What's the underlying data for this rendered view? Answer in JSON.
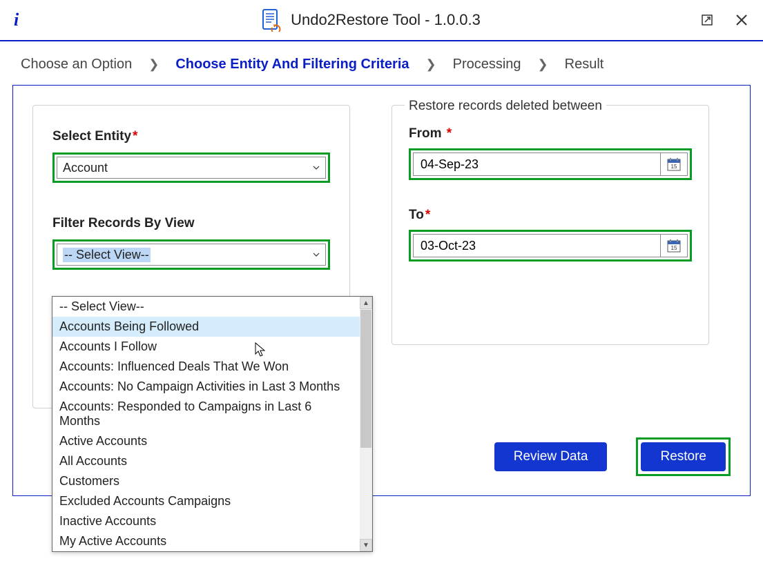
{
  "titlebar": {
    "app_title": "Undo2Restore Tool - 1.0.0.3"
  },
  "breadcrumb": {
    "step1": "Choose an Option",
    "step2": "Choose Entity And Filtering Criteria",
    "step3": "Processing",
    "step4": "Result"
  },
  "left": {
    "entity_label": "Select Entity",
    "entity_value": "Account",
    "filter_label": "Filter Records By View",
    "filter_value": "-- Select View--"
  },
  "dropdown": {
    "items": [
      "-- Select View--",
      "Accounts Being Followed",
      "Accounts I Follow",
      "Accounts: Influenced Deals That We Won",
      "Accounts: No Campaign Activities in Last 3 Months",
      "Accounts: Responded to Campaigns in Last 6 Months",
      "Active Accounts",
      "All Accounts",
      "Customers",
      "Excluded Accounts Campaigns",
      "Inactive Accounts",
      "My Active Accounts"
    ]
  },
  "right": {
    "legend": "Restore records deleted between",
    "from_label": "From",
    "from_value": "04-Sep-23",
    "to_label": "To",
    "to_value": "03-Oct-23"
  },
  "actions": {
    "review": "Review Data",
    "restore": "Restore"
  }
}
